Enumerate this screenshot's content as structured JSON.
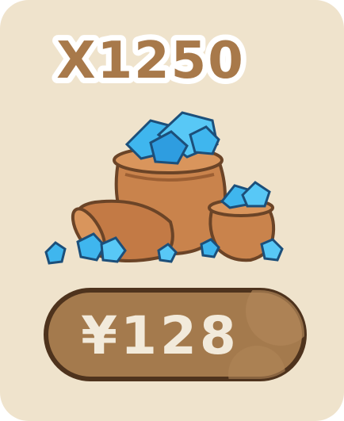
{
  "offer": {
    "quantity_label": "X1250",
    "price_label": "¥128",
    "item_icon": "gem-bags-icon"
  },
  "colors": {
    "card_background": "#efe3cc",
    "text_brown": "#a8794a",
    "text_outline": "#ffffff",
    "button_fill": "#a47a4d",
    "button_border": "#4e331d",
    "price_text": "#f2eadb",
    "bag": "#c9834c",
    "gem": "#3fb6ee"
  }
}
